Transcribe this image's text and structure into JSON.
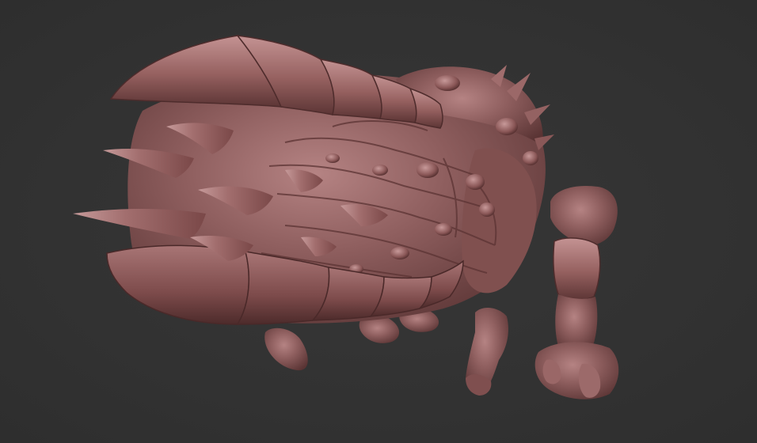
{
  "scene": {
    "background_color": "#333333",
    "material_color": "#8a5a5a",
    "subject": "sculpted-creature"
  }
}
